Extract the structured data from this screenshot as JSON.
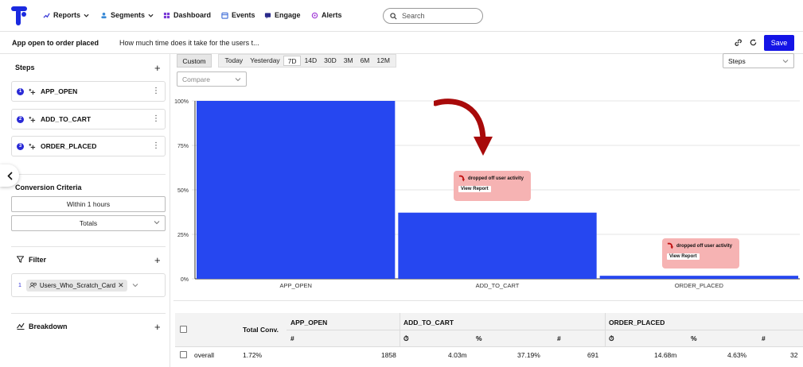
{
  "nav": {
    "items": [
      {
        "label": "Reports",
        "icon": "reports-icon",
        "has_dropdown": true
      },
      {
        "label": "Segments",
        "icon": "segments-icon",
        "has_dropdown": true
      },
      {
        "label": "Dashboard",
        "icon": "dashboard-icon",
        "has_dropdown": false
      },
      {
        "label": "Events",
        "icon": "events-icon",
        "has_dropdown": false
      },
      {
        "label": "Engage",
        "icon": "engage-icon",
        "has_dropdown": false
      },
      {
        "label": "Alerts",
        "icon": "alerts-icon",
        "has_dropdown": false
      }
    ],
    "search_placeholder": "Search"
  },
  "report": {
    "title": "App open to order placed",
    "description": "How much time does it take for the users t...",
    "save_label": "Save"
  },
  "sidebar": {
    "steps_title": "Steps",
    "steps": [
      {
        "num": "1",
        "name": "APP_OPEN"
      },
      {
        "num": "2",
        "name": "ADD_TO_CART"
      },
      {
        "num": "3",
        "name": "ORDER_PLACED"
      }
    ],
    "conversion_title": "Conversion Criteria",
    "within": "Within 1 hours",
    "totals": "Totals",
    "filter_title": "Filter",
    "filter_index": "1",
    "filter_chip": "Users_Who_Scratch_Card",
    "breakdown_title": "Breakdown"
  },
  "toolbar": {
    "custom_label": "Custom",
    "ranges": [
      "Today",
      "Yesterday",
      "7D",
      "14D",
      "30D",
      "3M",
      "6M",
      "12M"
    ],
    "active_range": "7D",
    "compare_placeholder": "Compare",
    "view_select": "Steps"
  },
  "chart_data": {
    "type": "bar",
    "categories": [
      "APP_OPEN",
      "ADD_TO_CART",
      "ORDER_PLACED"
    ],
    "values": [
      100,
      37.19,
      1.72
    ],
    "ylim": [
      0,
      100
    ],
    "y_ticks": [
      "100%",
      "75%",
      "50%",
      "25%",
      "0%"
    ],
    "grid": true,
    "color": "#2647f0"
  },
  "tooltips": [
    {
      "text": "dropped off user activity",
      "button": "View Report"
    },
    {
      "text": "dropped off user activity",
      "button": "View Report"
    }
  ],
  "colors": {
    "accent": "#1414e6",
    "bar": "#2647f0",
    "tooltip_bg": "#f6b3b3",
    "arrow": "#a80a0a"
  },
  "table": {
    "total_conv_header": "Total Conv.",
    "groups": [
      "APP_OPEN",
      "ADD_TO_CART",
      "ORDER_PLACED"
    ],
    "subheaders": [
      "#",
      "⏱",
      "%",
      "#",
      "⏱",
      "%",
      "#"
    ],
    "row": {
      "label": "overall",
      "total_conv": "1.72%",
      "app_open_count": "1858",
      "add_to_cart_time": "4.03m",
      "add_to_cart_pct": "37.19%",
      "add_to_cart_count": "691",
      "order_placed_time": "14.68m",
      "order_placed_pct": "4.63%",
      "order_placed_count": "32"
    }
  }
}
